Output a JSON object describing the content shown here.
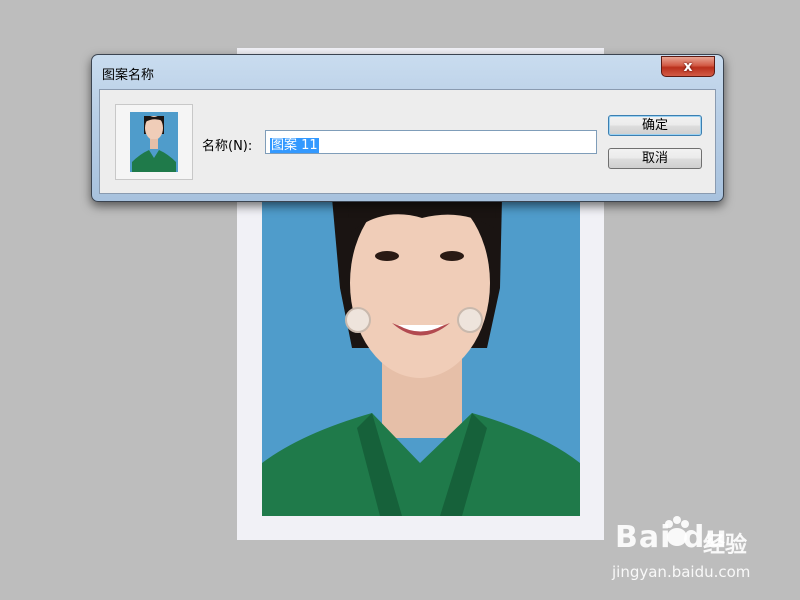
{
  "dialog": {
    "title": "图案名称",
    "close_glyph": "x",
    "name_label": "名称(N):",
    "name_value": "图案 11",
    "ok_label": "确定",
    "cancel_label": "取消"
  },
  "watermark": {
    "logo_text": "Bai du",
    "logo_cn": "经验",
    "url": "jingyan.baidu.com"
  },
  "colors": {
    "photo_background": "#4f9ccb",
    "jacket": "#1f7a4a",
    "selection": "#3399ff"
  }
}
